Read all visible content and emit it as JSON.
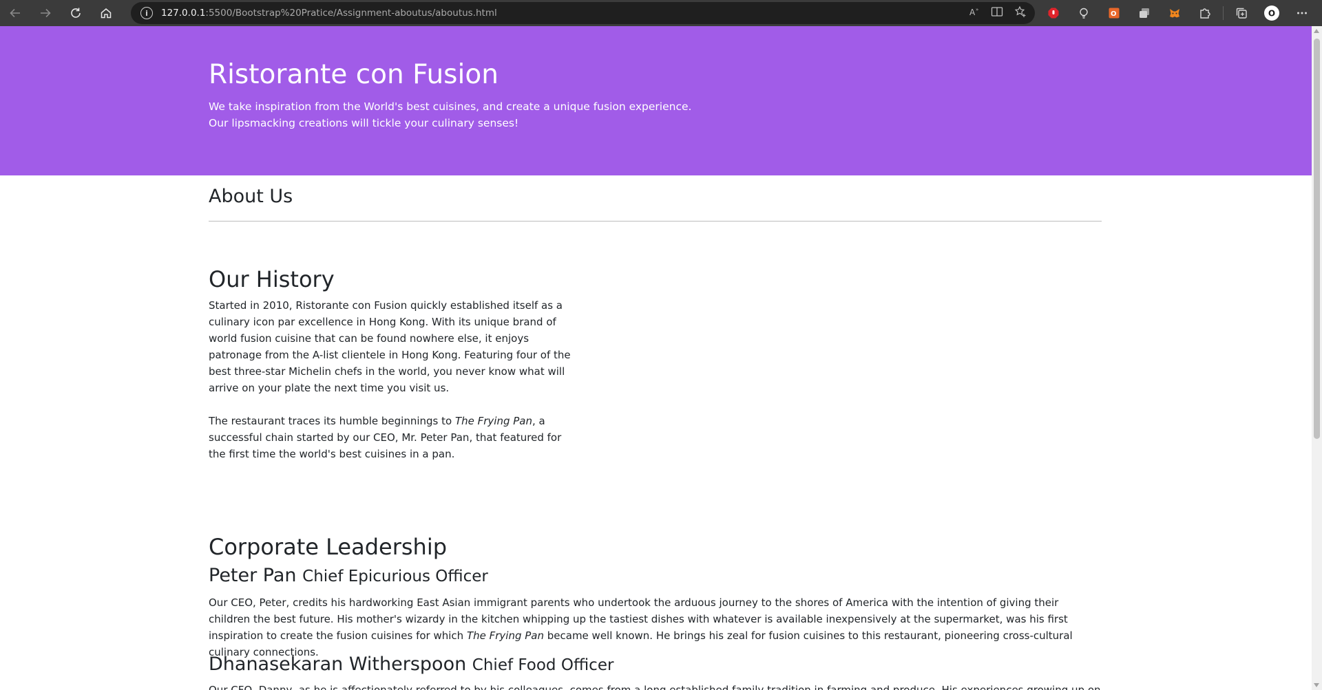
{
  "browser": {
    "url_host": "127.0.0.1",
    "url_rest": ":5500/Bootstrap%20Pratice/Assignment-aboutus/aboutus.html",
    "profile_initial": "O"
  },
  "header": {
    "title": "Ristorante con Fusion",
    "tagline_line1": "We take inspiration from the World's best cuisines, and create a unique fusion experience.",
    "tagline_line2": "Our lipsmacking creations will tickle your culinary senses!"
  },
  "about": {
    "title": "About Us"
  },
  "history": {
    "heading": "Our History",
    "para1": "Started in 2010, Ristorante con Fusion quickly established itself as a culinary icon par excellence in Hong Kong. With its unique brand of world fusion cuisine that can be found nowhere else, it enjoys patronage from the A-list clientele in Hong Kong. Featuring four of the best three-star Michelin chefs in the world, you never know what will arrive on your plate the next time you visit us.",
    "para2_before": "The restaurant traces its humble beginnings to ",
    "para2_em": "The Frying Pan",
    "para2_after": ", a successful chain started by our CEO, Mr. Peter Pan, that featured for the first time the world's best cuisines in a pan."
  },
  "leadership": {
    "heading": "Corporate Leadership",
    "leaders": [
      {
        "name": "Peter Pan",
        "role": "Chief Epicurious Officer",
        "bio_before": "Our CEO, Peter, credits his hardworking East Asian immigrant parents who undertook the arduous journey to the shores of America with the intention of giving their children the best future. His mother's wizardy in the kitchen whipping up the tastiest dishes with whatever is available inexpensively at the supermarket, was his first inspiration to create the fusion cuisines for which ",
        "bio_em": "The Frying Pan",
        "bio_after": " became well known. He brings his zeal for fusion cuisines to this restaurant, pioneering cross-cultural culinary connections."
      },
      {
        "name": "Dhanasekaran Witherspoon",
        "role": "Chief Food Officer",
        "bio": "Our CFO, Danny, as he is affectionately referred to by his colleagues, comes from a long established family tradition in farming and produce. His experiences growing up on a farm in"
      }
    ]
  },
  "colors": {
    "jumbotron": "#a15ce8",
    "chrome": "#3b3b3b",
    "text": "#212529"
  },
  "icons": [
    "back-icon",
    "forward-icon",
    "refresh-icon",
    "home-icon",
    "info-icon",
    "read-aloud-icon",
    "immersive-reader-icon",
    "favorite-add-icon",
    "adblock-icon",
    "lightbulb-icon",
    "office-icon",
    "tab-extension-icon",
    "metamask-icon",
    "extensions-icon",
    "collections-icon",
    "profile-icon",
    "more-icon"
  ]
}
